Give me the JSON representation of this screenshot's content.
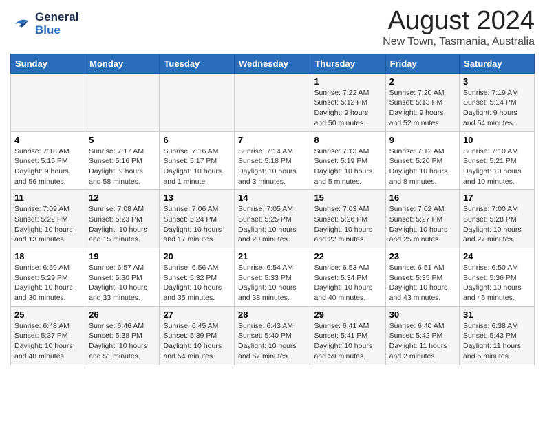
{
  "logo": {
    "line1": "General",
    "line2": "Blue"
  },
  "title": "August 2024",
  "subtitle": "New Town, Tasmania, Australia",
  "days_of_week": [
    "Sunday",
    "Monday",
    "Tuesday",
    "Wednesday",
    "Thursday",
    "Friday",
    "Saturday"
  ],
  "weeks": [
    [
      {
        "day": "",
        "info": ""
      },
      {
        "day": "",
        "info": ""
      },
      {
        "day": "",
        "info": ""
      },
      {
        "day": "",
        "info": ""
      },
      {
        "day": "1",
        "info": "Sunrise: 7:22 AM\nSunset: 5:12 PM\nDaylight: 9 hours\nand 50 minutes."
      },
      {
        "day": "2",
        "info": "Sunrise: 7:20 AM\nSunset: 5:13 PM\nDaylight: 9 hours\nand 52 minutes."
      },
      {
        "day": "3",
        "info": "Sunrise: 7:19 AM\nSunset: 5:14 PM\nDaylight: 9 hours\nand 54 minutes."
      }
    ],
    [
      {
        "day": "4",
        "info": "Sunrise: 7:18 AM\nSunset: 5:15 PM\nDaylight: 9 hours\nand 56 minutes."
      },
      {
        "day": "5",
        "info": "Sunrise: 7:17 AM\nSunset: 5:16 PM\nDaylight: 9 hours\nand 58 minutes."
      },
      {
        "day": "6",
        "info": "Sunrise: 7:16 AM\nSunset: 5:17 PM\nDaylight: 10 hours\nand 1 minute."
      },
      {
        "day": "7",
        "info": "Sunrise: 7:14 AM\nSunset: 5:18 PM\nDaylight: 10 hours\nand 3 minutes."
      },
      {
        "day": "8",
        "info": "Sunrise: 7:13 AM\nSunset: 5:19 PM\nDaylight: 10 hours\nand 5 minutes."
      },
      {
        "day": "9",
        "info": "Sunrise: 7:12 AM\nSunset: 5:20 PM\nDaylight: 10 hours\nand 8 minutes."
      },
      {
        "day": "10",
        "info": "Sunrise: 7:10 AM\nSunset: 5:21 PM\nDaylight: 10 hours\nand 10 minutes."
      }
    ],
    [
      {
        "day": "11",
        "info": "Sunrise: 7:09 AM\nSunset: 5:22 PM\nDaylight: 10 hours\nand 13 minutes."
      },
      {
        "day": "12",
        "info": "Sunrise: 7:08 AM\nSunset: 5:23 PM\nDaylight: 10 hours\nand 15 minutes."
      },
      {
        "day": "13",
        "info": "Sunrise: 7:06 AM\nSunset: 5:24 PM\nDaylight: 10 hours\nand 17 minutes."
      },
      {
        "day": "14",
        "info": "Sunrise: 7:05 AM\nSunset: 5:25 PM\nDaylight: 10 hours\nand 20 minutes."
      },
      {
        "day": "15",
        "info": "Sunrise: 7:03 AM\nSunset: 5:26 PM\nDaylight: 10 hours\nand 22 minutes."
      },
      {
        "day": "16",
        "info": "Sunrise: 7:02 AM\nSunset: 5:27 PM\nDaylight: 10 hours\nand 25 minutes."
      },
      {
        "day": "17",
        "info": "Sunrise: 7:00 AM\nSunset: 5:28 PM\nDaylight: 10 hours\nand 27 minutes."
      }
    ],
    [
      {
        "day": "18",
        "info": "Sunrise: 6:59 AM\nSunset: 5:29 PM\nDaylight: 10 hours\nand 30 minutes."
      },
      {
        "day": "19",
        "info": "Sunrise: 6:57 AM\nSunset: 5:30 PM\nDaylight: 10 hours\nand 33 minutes."
      },
      {
        "day": "20",
        "info": "Sunrise: 6:56 AM\nSunset: 5:32 PM\nDaylight: 10 hours\nand 35 minutes."
      },
      {
        "day": "21",
        "info": "Sunrise: 6:54 AM\nSunset: 5:33 PM\nDaylight: 10 hours\nand 38 minutes."
      },
      {
        "day": "22",
        "info": "Sunrise: 6:53 AM\nSunset: 5:34 PM\nDaylight: 10 hours\nand 40 minutes."
      },
      {
        "day": "23",
        "info": "Sunrise: 6:51 AM\nSunset: 5:35 PM\nDaylight: 10 hours\nand 43 minutes."
      },
      {
        "day": "24",
        "info": "Sunrise: 6:50 AM\nSunset: 5:36 PM\nDaylight: 10 hours\nand 46 minutes."
      }
    ],
    [
      {
        "day": "25",
        "info": "Sunrise: 6:48 AM\nSunset: 5:37 PM\nDaylight: 10 hours\nand 48 minutes."
      },
      {
        "day": "26",
        "info": "Sunrise: 6:46 AM\nSunset: 5:38 PM\nDaylight: 10 hours\nand 51 minutes."
      },
      {
        "day": "27",
        "info": "Sunrise: 6:45 AM\nSunset: 5:39 PM\nDaylight: 10 hours\nand 54 minutes."
      },
      {
        "day": "28",
        "info": "Sunrise: 6:43 AM\nSunset: 5:40 PM\nDaylight: 10 hours\nand 57 minutes."
      },
      {
        "day": "29",
        "info": "Sunrise: 6:41 AM\nSunset: 5:41 PM\nDaylight: 10 hours\nand 59 minutes."
      },
      {
        "day": "30",
        "info": "Sunrise: 6:40 AM\nSunset: 5:42 PM\nDaylight: 11 hours\nand 2 minutes."
      },
      {
        "day": "31",
        "info": "Sunrise: 6:38 AM\nSunset: 5:43 PM\nDaylight: 11 hours\nand 5 minutes."
      }
    ]
  ]
}
